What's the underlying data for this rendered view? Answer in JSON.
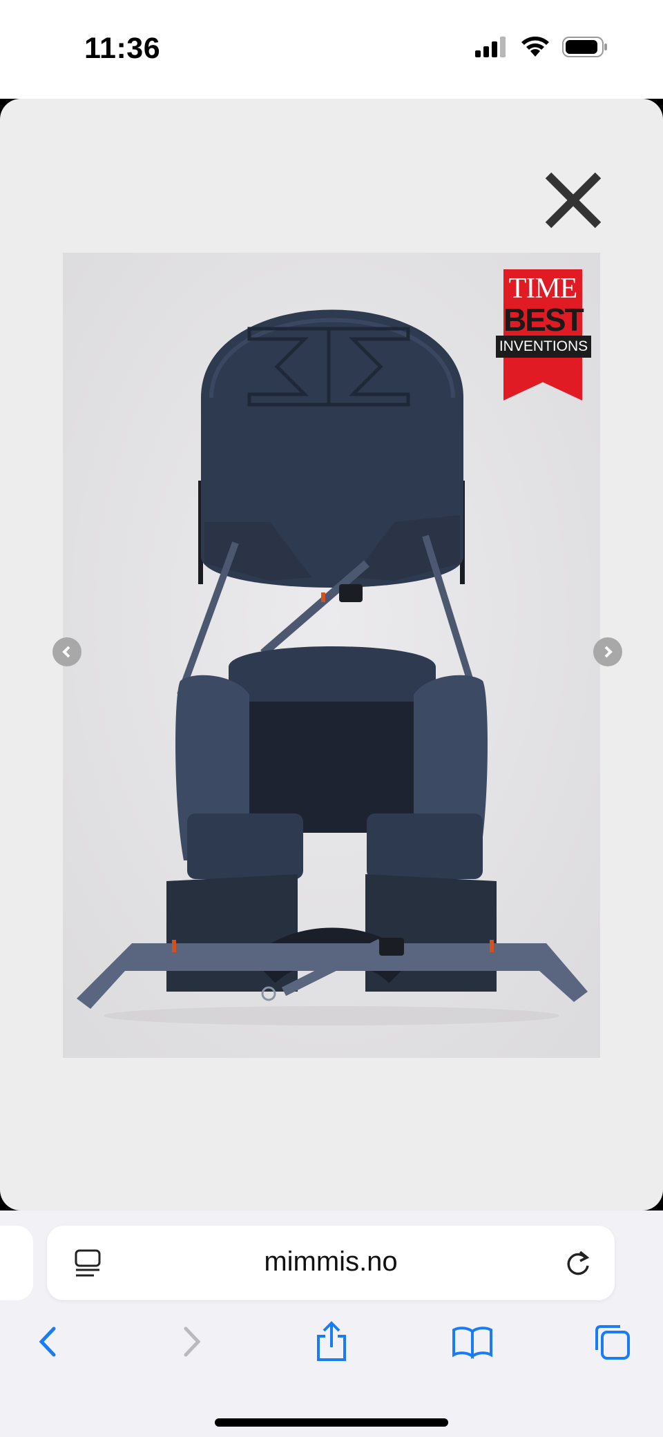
{
  "status_bar": {
    "time": "11:36"
  },
  "modal": {
    "badge": {
      "line1": "TIME",
      "line2": "BEST",
      "line3": "INVENTIONS"
    }
  },
  "browser": {
    "url": "mimmis.no"
  },
  "colors": {
    "accent": "#1a7cf5",
    "badge_red": "#e01b24",
    "product": "#2e3a4f"
  },
  "icons": [
    "signal-icon",
    "wifi-icon",
    "battery-icon",
    "close-icon",
    "chevron-left-icon",
    "chevron-right-icon",
    "reader-icon",
    "reload-icon",
    "back-icon",
    "forward-icon",
    "share-icon",
    "bookmarks-icon",
    "tabs-icon"
  ]
}
